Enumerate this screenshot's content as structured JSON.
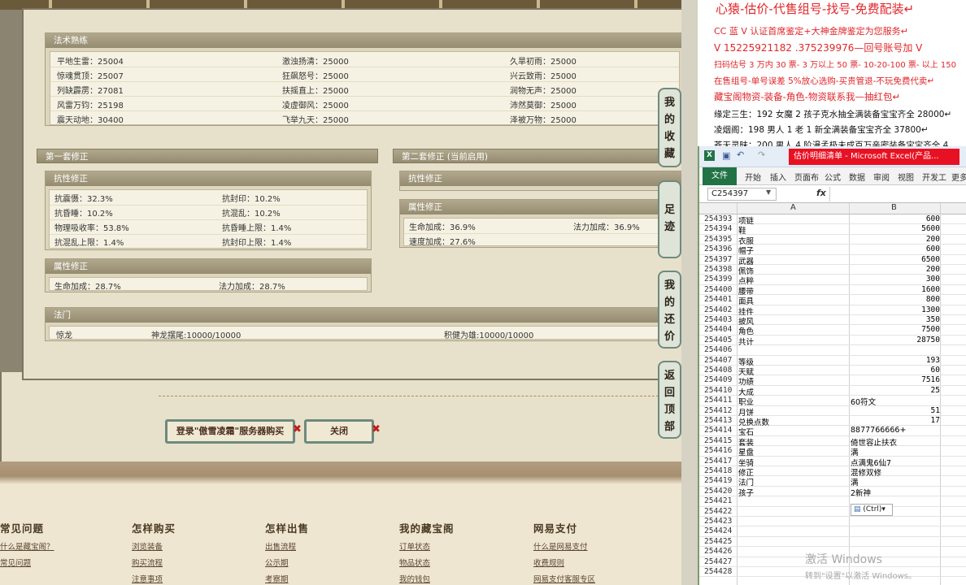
{
  "game": {
    "spell_section": {
      "title": "法术熟练",
      "rows": [
        [
          "平地生雷：25004",
          "激浊扬清：25000",
          "久旱初雨：25000"
        ],
        [
          "惊魂贯顶：25007",
          "狂飙怒号：25000",
          "兴云致雨：25000"
        ],
        [
          "列缺霹雳：27081",
          "扶摇直上：25000",
          "润物无声：25000"
        ],
        [
          "风雷万钧：25198",
          "凌虚御风：25000",
          "沛然莫御：25000"
        ],
        [
          "震天动地：30400",
          "飞举九天：25000",
          "泽被万物：25000"
        ]
      ]
    },
    "set1": {
      "title": "第一套修正",
      "resist_title": "抗性修正",
      "resist_rows": [
        [
          "抗震慑：32.3%",
          "抗封印：10.2%"
        ],
        [
          "抗昏睡：10.2%",
          "抗混乱：10.2%"
        ],
        [
          "物理吸收率：53.8%",
          "抗昏睡上限：1.4%"
        ],
        [
          "抗混乱上限：1.4%",
          "抗封印上限：1.4%"
        ]
      ],
      "attr_title": "属性修正",
      "attr_rows": [
        [
          "生命加成：28.7%",
          "法力加成：28.7%"
        ]
      ]
    },
    "set2": {
      "title": "第二套修正 (当前启用)",
      "resist_title": "抗性修正",
      "attr_title": "属性修正",
      "attr_rows": [
        [
          "生命加成：36.9%",
          "法力加成：36.9%"
        ],
        [
          "速度加成：27.6%",
          ""
        ]
      ]
    },
    "method": {
      "title": "法门",
      "cols": [
        "惊龙",
        "神龙摆尾:10000/10000",
        "积健为雄:10000/10000"
      ]
    },
    "buttons": {
      "login": "登录\"傲雪凌霜\"服务器购买",
      "close": "关闭",
      "x": "✖"
    },
    "side": {
      "fav": [
        "我",
        "的",
        "收",
        "藏"
      ],
      "track": [
        "足",
        "迹"
      ],
      "bargain": [
        "我",
        "的",
        "还",
        "价"
      ],
      "top": [
        "返",
        "回",
        "顶",
        "部"
      ]
    },
    "footer": [
      {
        "title": "常见问题",
        "links": [
          "什么是藏宝阁？",
          "常见问题"
        ]
      },
      {
        "title": "怎样购买",
        "links": [
          "浏览装备",
          "购买流程",
          "注意事项"
        ]
      },
      {
        "title": "怎样出售",
        "links": [
          "出售流程",
          "公示期",
          "考察期"
        ]
      },
      {
        "title": "我的藏宝阁",
        "links": [
          "订单状态",
          "物品状态",
          "我的钱包"
        ]
      },
      {
        "title": "网易支付",
        "links": [
          "什么是网易支付",
          "收费规则",
          "网易支付客服专区"
        ]
      }
    ]
  },
  "notes": {
    "lines": [
      "心猿-估价-代售组号-找号-免费配装↵",
      "CC 蓝 V 认证首席鉴定+大神金牌鉴定为您服务↵",
      "V 15225921182   .375239976—回号账号加 V",
      "扫码估号 3 万内 30 票- 3 万以上 50 票- 10-20-100 票- 以上 150",
      "在售组号-单号误差 5%放心选购-买贵管退-不玩免费代卖↵",
      "藏宝阁物资-装备-角色-物资联系我—抽红包↵",
      "缘定三生：192 女魔 2 孩子克水抽全满装备宝宝齐全 28000↵",
      "凌烟阁：198 男人 1 老 1 新全满装备宝宝齐全 37800↵",
      "苍天灵昧：200 男人 4 阶漫孟极未成百万亲密装备宝宝齐全 4"
    ]
  },
  "excel": {
    "title": "估价明细清单 - Microsoft Excel(产品...",
    "tabs": [
      "开始",
      "插入",
      "页面布",
      "公式",
      "数据",
      "审阅",
      "视图",
      "开发工",
      "更多"
    ],
    "file_tab": "文件",
    "namebox": "C254397",
    "fx": "fx",
    "col_headers": [
      "A",
      "B"
    ],
    "rows": [
      {
        "n": "254393",
        "a": "项链",
        "b": "600"
      },
      {
        "n": "254394",
        "a": "鞋",
        "b": "5600"
      },
      {
        "n": "254395",
        "a": "衣服",
        "b": "200"
      },
      {
        "n": "254396",
        "a": "帽子",
        "b": "600"
      },
      {
        "n": "254397",
        "a": "武器",
        "b": "6500"
      },
      {
        "n": "254398",
        "a": "佩饰",
        "b": "200"
      },
      {
        "n": "254399",
        "a": "点粹",
        "b": "300"
      },
      {
        "n": "254400",
        "a": "腰带",
        "b": "1600"
      },
      {
        "n": "254401",
        "a": "面具",
        "b": "800"
      },
      {
        "n": "254402",
        "a": "挂件",
        "b": "1300"
      },
      {
        "n": "254403",
        "a": "披风",
        "b": "350"
      },
      {
        "n": "254404",
        "a": "角色",
        "b": "7500"
      },
      {
        "n": "254405",
        "a": "共计",
        "b": "28750"
      },
      {
        "n": "254406",
        "a": "",
        "b": ""
      },
      {
        "n": "254407",
        "a": "等级",
        "b": "193"
      },
      {
        "n": "254408",
        "a": "天赋",
        "b": "60"
      },
      {
        "n": "254409",
        "a": "功绩",
        "b": "7516"
      },
      {
        "n": "254410",
        "a": "大成",
        "b": "25"
      },
      {
        "n": "254411",
        "a": "职业",
        "t": "60符文"
      },
      {
        "n": "254412",
        "a": "月饼",
        "b": "51"
      },
      {
        "n": "254413",
        "a": "兑换点数",
        "b": "17"
      },
      {
        "n": "254414",
        "a": "宝石",
        "t": "8877766666+"
      },
      {
        "n": "254415",
        "a": "套装",
        "t": "倚世容止扶衣"
      },
      {
        "n": "254416",
        "a": "星盘",
        "t": "满"
      },
      {
        "n": "254417",
        "a": "坐骑",
        "t": "点满鬼6仙7"
      },
      {
        "n": "254418",
        "a": "修正",
        "t": "混修双修"
      },
      {
        "n": "254419",
        "a": "法门",
        "t": "满"
      },
      {
        "n": "254420",
        "a": "孩子",
        "t": "2新神"
      },
      {
        "n": "254421",
        "a": "",
        "b": ""
      },
      {
        "n": "254422",
        "a": "",
        "b": ""
      },
      {
        "n": "254423",
        "a": "",
        "b": ""
      },
      {
        "n": "254424",
        "a": "",
        "b": ""
      },
      {
        "n": "254425",
        "a": "",
        "b": ""
      },
      {
        "n": "254426",
        "a": "",
        "b": ""
      },
      {
        "n": "254427",
        "a": "",
        "b": ""
      },
      {
        "n": "254428",
        "a": "",
        "b": ""
      }
    ],
    "ctrl_label": "(Ctrl)▾"
  },
  "watermark": {
    "line1": "激活 Windows",
    "line2": "转到\"设置\"以激活 Windows。"
  }
}
